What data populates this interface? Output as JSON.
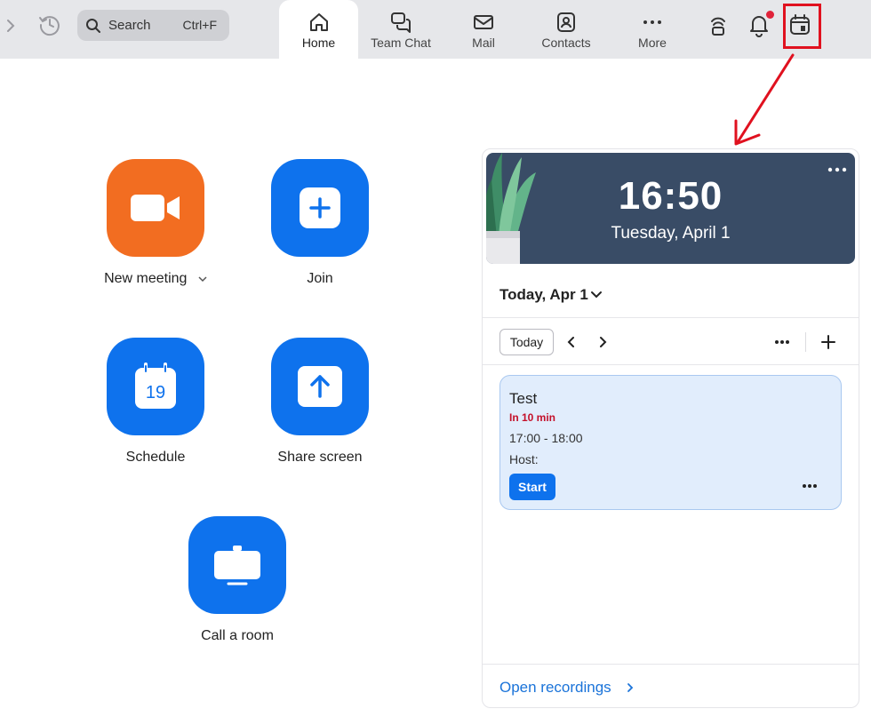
{
  "topbar": {
    "search": {
      "label": "Search",
      "shortcut": "Ctrl+F"
    },
    "tabs": [
      {
        "label": "Home",
        "icon": "home-icon",
        "active": true
      },
      {
        "label": "Team Chat",
        "icon": "chat-icon",
        "active": false
      },
      {
        "label": "Mail",
        "icon": "mail-icon",
        "active": false
      },
      {
        "label": "Contacts",
        "icon": "contacts-icon",
        "active": false
      },
      {
        "label": "More",
        "icon": "more-icon",
        "active": false
      }
    ],
    "right_icons": [
      "phone-handset-icon",
      "bell-icon",
      "calendar-icon"
    ],
    "notification_dot_color": "#e0233a",
    "highlight_color": "#e0111f"
  },
  "actions": [
    {
      "label": "New meeting",
      "icon": "video-camera-icon",
      "color": "#f26d21",
      "has_dropdown": true
    },
    {
      "label": "Join",
      "icon": "plus-icon",
      "color": "#0e72ed"
    },
    {
      "label": "Schedule",
      "icon": "calendar-19-icon",
      "color": "#0e72ed",
      "icon_text": "19"
    },
    {
      "label": "Share screen",
      "icon": "upload-arrow-icon",
      "color": "#0e72ed"
    },
    {
      "label": "Call a room",
      "icon": "monitor-icon",
      "color": "#0e72ed"
    }
  ],
  "calendar": {
    "clock": {
      "time": "16:50",
      "date": "Tuesday, April 1"
    },
    "date_heading": "Today, Apr 1",
    "today_button": "Today",
    "event": {
      "title": "Test",
      "relative": "In 10 min",
      "time_range": "17:00 - 18:00",
      "host_label": "Host:",
      "start_button": "Start"
    },
    "open_recordings": "Open recordings"
  }
}
